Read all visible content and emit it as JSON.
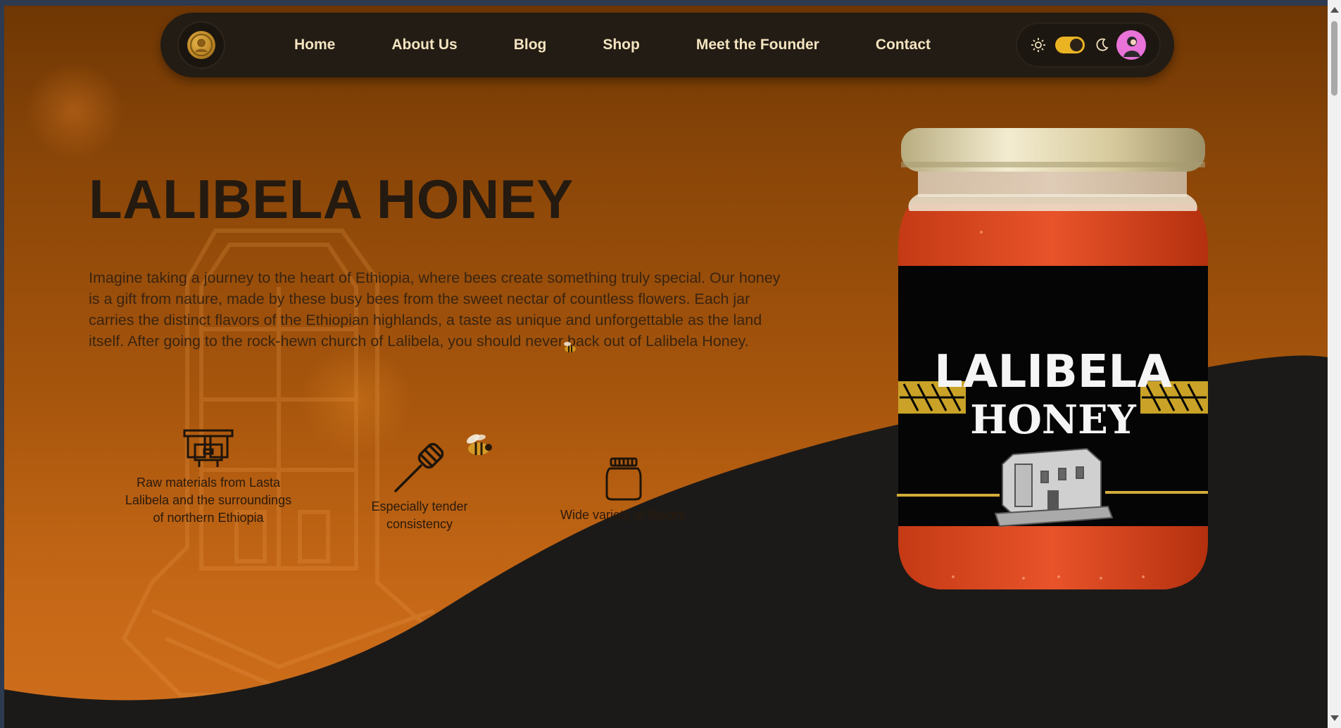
{
  "nav": {
    "links": [
      "Home",
      "About Us",
      "Blog",
      "Shop",
      "Meet the Founder",
      "Contact"
    ],
    "theme_toggle_state": "dark"
  },
  "hero": {
    "title": "LALIBELA HONEY",
    "description": "Imagine taking a journey to the heart of Ethiopia, where bees create something truly special. Our honey is a gift from nature, made by these busy bees from the sweet nectar of countless flowers. Each jar carries the distinct flavors of the Ethiopian highlands, a taste as unique and unforgettable as the land itself. After going to the rock-hewn church of Lalibela, you should never back out of Lalibela Honey."
  },
  "features": [
    {
      "icon": "beehive-icon",
      "label": "Raw materials from Lasta Lalibela and the surroundings of northern Ethiopia"
    },
    {
      "icon": "honey-dipper-icon",
      "label": "Especially tender consistency"
    },
    {
      "icon": "jar-icon",
      "label": "Wide variety of flavors"
    }
  ],
  "jar_label": {
    "line1": "LALIBELA",
    "line2": "HONEY"
  },
  "colors": {
    "background_top": "#6f3704",
    "background_bottom": "#cf6e1b",
    "wave_dark": "#1c1a18",
    "nav_bg": "#231c14",
    "nav_text": "#f3e4c0",
    "accent": "#e9b323",
    "avatar_bg": "#e973d9"
  }
}
